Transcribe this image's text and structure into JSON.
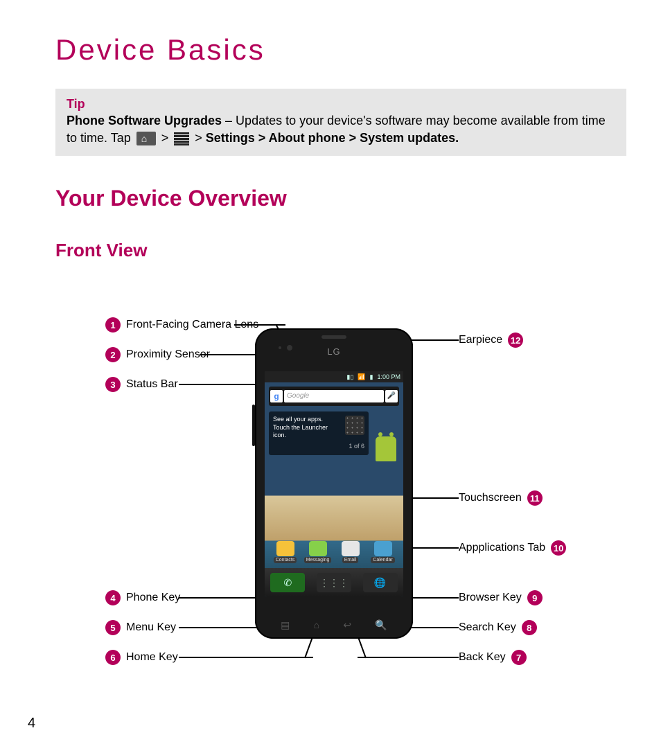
{
  "title": "Device Basics",
  "tip": {
    "head": "Tip",
    "bold": "Phone Software Upgrades",
    "line1a": " – Updates to your device's software may become available from time to time. Tap ",
    "gt1": " > ",
    "gt2": " > ",
    "path": "Settings > About phone > System updates."
  },
  "headings": {
    "overview": "Your Device Overview",
    "front": "Front View"
  },
  "phone": {
    "logo": "LG",
    "time": "1:00 PM",
    "search_placeholder": "Google",
    "hint_line1": "See all your apps.",
    "hint_line2": "Touch the Launcher icon.",
    "hint_page": "1 of 6",
    "dock": [
      "Contacts",
      "Messaging",
      "Email",
      "Calendar"
    ]
  },
  "callouts": {
    "c1": "Front-Facing Camera Lens",
    "c2": "Proximity Sensor",
    "c3": "Status Bar",
    "c4": "Phone Key",
    "c5": "Menu Key",
    "c6": "Home Key",
    "c7": "Back Key",
    "c8": "Search Key",
    "c9": "Browser Key",
    "c10": "Appplications Tab",
    "c11": "Touchscreen",
    "c12": "Earpiece"
  },
  "page_number": "4"
}
